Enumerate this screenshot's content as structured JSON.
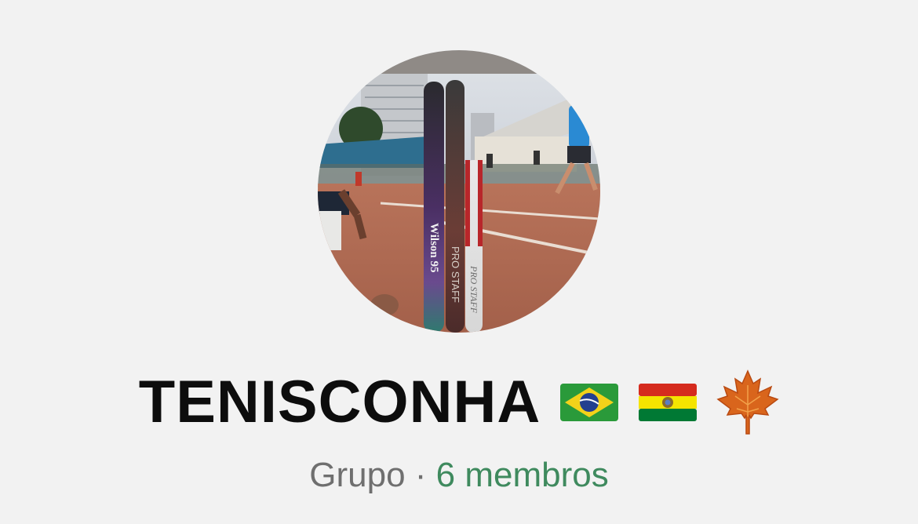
{
  "group": {
    "name": "TENISCONHA",
    "type_label": "Grupo",
    "separator": " · ",
    "members_label": "6 membros"
  },
  "avatar": {
    "racquet_texts": [
      "Wilson 95",
      "PRO STAFF",
      "PRO STAFF"
    ]
  },
  "emojis": [
    "brazil-flag",
    "bolivia-flag",
    "maple-leaf"
  ],
  "colors": {
    "background": "#f2f2f2",
    "title": "#0d0d0d",
    "subtitle_gray": "#6f6f6f",
    "members_green": "#3f8a5e"
  }
}
